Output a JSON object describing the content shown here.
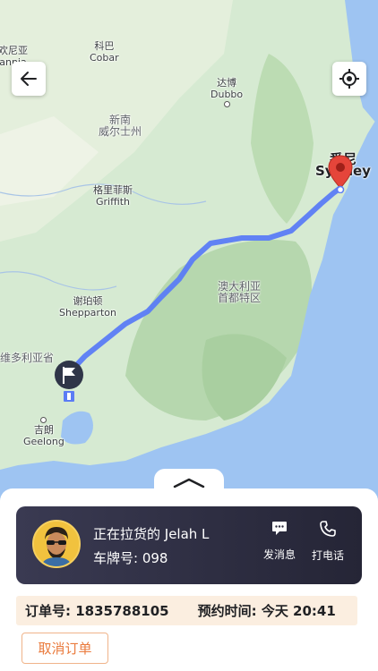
{
  "map": {
    "labels": {
      "victoria_fragment_cn": "欢尼亚",
      "victoria_fragment_en": "annia",
      "cobar_cn": "科巴",
      "cobar_en": "Cobar",
      "dubbo_cn": "达博",
      "dubbo_en": "Dubbo",
      "nsw_cn_1": "新南",
      "nsw_cn_2": "威尔士州",
      "griffith_cn": "格里菲斯",
      "griffith_en": "Griffith",
      "sydney_cn": "悉尼",
      "sydney_en": "Sydney",
      "act_cn_1": "澳大利亚",
      "act_cn_2": "首都特区",
      "shepparton_cn": "谢珀顿",
      "shepparton_en": "Shepparton",
      "vic_cn": "维多利亚省",
      "geelong_cn": "吉朗",
      "geelong_en": "Geelong"
    },
    "colors": {
      "route": "#5b7cf5",
      "pin": "#e5453a",
      "water": "#9ec4f2",
      "land": "#cfe6c7"
    }
  },
  "header": {
    "back_icon": "arrow-left-icon",
    "locate_icon": "crosshair-locate-icon"
  },
  "driver": {
    "status_text": "正在拉货的 Jelah L",
    "plate_text": "车牌号: 098",
    "message_label": "发消息",
    "call_label": "打电话"
  },
  "order": {
    "order_no_text": "订单号: 1835788105",
    "appointment_text": "预约时间: 今天 20:41"
  },
  "actions": {
    "cancel_label": "取消订单"
  }
}
